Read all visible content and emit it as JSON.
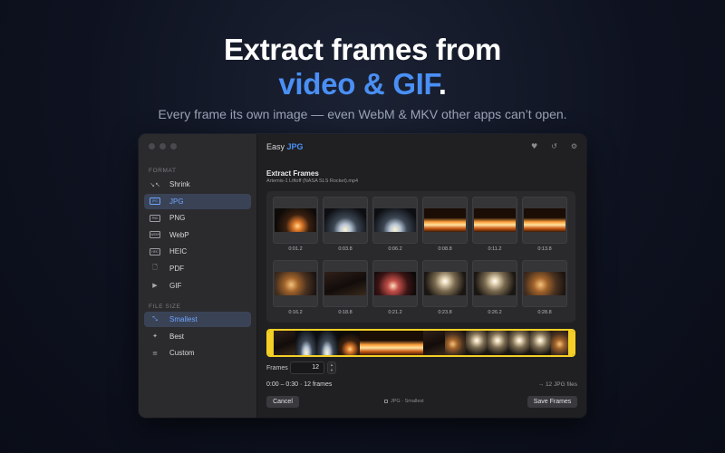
{
  "hero": {
    "title_line1": "Extract frames from",
    "title_accent": "video & GIF",
    "title_period": ".",
    "subtitle": "Every frame its own image — even WebM & MKV other apps can’t open."
  },
  "app": {
    "brand_prefix": "Easy",
    "brand_accent": "JPG",
    "accent_color": "#4a8ff5"
  },
  "sidebar": {
    "format_label": "FORMAT",
    "format_items": [
      {
        "label": "Shrink",
        "icon": "shrink-icon",
        "glyph": "↘↖",
        "active": false
      },
      {
        "label": "JPG",
        "icon": "jpg-badge-icon",
        "glyph": "JPG",
        "active": true
      },
      {
        "label": "PNG",
        "icon": "png-badge-icon",
        "glyph": "PNG",
        "active": false
      },
      {
        "label": "WebP",
        "icon": "webp-badge-icon",
        "glyph": "WEBP",
        "active": false
      },
      {
        "label": "HEIC",
        "icon": "heic-badge-icon",
        "glyph": "HEIC",
        "active": false
      },
      {
        "label": "PDF",
        "icon": "document-icon",
        "glyph": "🗋",
        "active": false
      },
      {
        "label": "GIF",
        "icon": "play-icon",
        "glyph": "▶",
        "active": false
      }
    ],
    "size_label": "FILE SIZE",
    "size_items": [
      {
        "label": "Smallest",
        "icon": "compress-icon",
        "glyph": "⤡",
        "active": true
      },
      {
        "label": "Best",
        "icon": "sparkle-icon",
        "glyph": "✦",
        "active": false
      },
      {
        "label": "Custom",
        "icon": "sliders-icon",
        "glyph": "≡",
        "active": false
      }
    ]
  },
  "main": {
    "section_title": "Extract Frames",
    "file_name": "Artemis-1 Liftoff (NASA SLS Rocket).mp4",
    "frames": [
      {
        "time": "0:01.2",
        "scene": "dawn"
      },
      {
        "time": "0:03.8",
        "scene": "beams"
      },
      {
        "time": "0:06.2",
        "scene": "beams"
      },
      {
        "time": "0:08.8",
        "scene": "fire"
      },
      {
        "time": "0:11.2",
        "scene": "fire"
      },
      {
        "time": "0:13.8",
        "scene": "fire"
      },
      {
        "time": "0:16.2",
        "scene": "tower"
      },
      {
        "time": "0:18.8",
        "scene": "dark"
      },
      {
        "time": "0:21.2",
        "scene": "pad"
      },
      {
        "time": "0:23.8",
        "scene": "flare"
      },
      {
        "time": "0:26.2",
        "scene": "flare"
      },
      {
        "time": "0:28.8",
        "scene": "tower"
      }
    ],
    "frames_label": "Frames",
    "frames_value": "12",
    "range_text": "0:00 – 0:30 · 12 frames",
    "output_count": "→ 12 JPG files",
    "cancel_label": "Cancel",
    "status": "JPG · Smallest",
    "save_label": "Save Frames"
  }
}
